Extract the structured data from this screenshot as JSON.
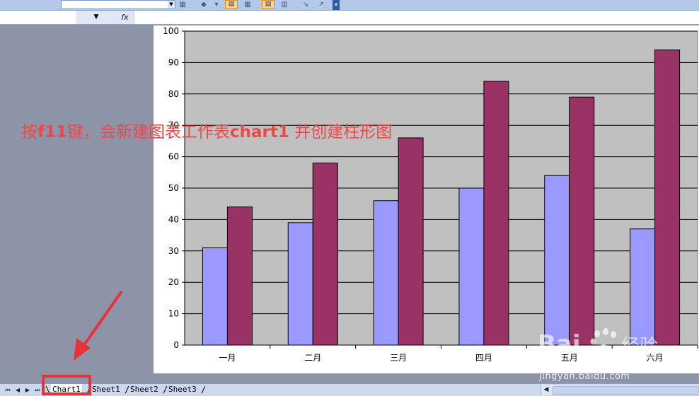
{
  "formula_bar": {
    "fx_label": "fx"
  },
  "chart_data": {
    "type": "bar",
    "categories": [
      "一月",
      "二月",
      "三月",
      "四月",
      "五月",
      "六月"
    ],
    "series": [
      {
        "values": [
          31,
          39,
          46,
          50,
          54,
          37
        ],
        "color": "#9999ff"
      },
      {
        "values": [
          44,
          58,
          66,
          84,
          79,
          94
        ],
        "color": "#993366"
      }
    ],
    "y_ticks": [
      "0",
      "10",
      "20",
      "30",
      "40",
      "50",
      "60",
      "70",
      "80",
      "90",
      "100"
    ],
    "ylim": [
      0,
      100
    ],
    "grid": true,
    "plot_background": "#c0c0c0"
  },
  "annotation": {
    "text_1": "按",
    "bold_1": "f11",
    "text_2": "键，会新建图表工作表",
    "bold_2": "chart1",
    "text_3": " 并创建柱形图",
    "color": "#ee4848"
  },
  "sheet_tabs": [
    "Chart1",
    "Sheet1",
    "Sheet2",
    "Sheet3"
  ],
  "active_tab": "Chart1",
  "watermark": {
    "logo": "Baidu经验",
    "url": "jingyan.baidu.com"
  }
}
